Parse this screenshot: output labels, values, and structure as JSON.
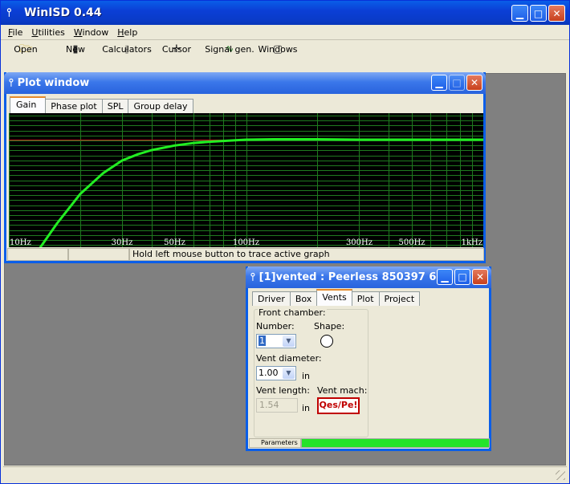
{
  "app": {
    "title": "WinISD 0.44"
  },
  "menu": [
    "File",
    "Utilities",
    "Window",
    "Help"
  ],
  "toolbar": [
    {
      "label": "Open",
      "icon": "folder-open-icon"
    },
    {
      "label": "New",
      "icon": "new-box-icon"
    },
    {
      "label": "Calculators",
      "icon": "calculator-icon"
    },
    {
      "label": "Cursor",
      "icon": "crosshair-cursor-icon"
    },
    {
      "label": "Signal gen.",
      "icon": "sine-wave-icon"
    },
    {
      "label": "Windows",
      "icon": "window-icon"
    }
  ],
  "plot_window": {
    "title": "Plot window",
    "tabs": [
      "Gain",
      "Phase plot",
      "SPL",
      "Group delay"
    ],
    "active_tab": "Gain",
    "status": [
      "",
      "",
      "Hold left mouse button to trace active graph"
    ]
  },
  "chart_data": {
    "type": "line",
    "xscale": "log",
    "xlim": [
      10,
      1000
    ],
    "x_tick_labels": [
      "10Hz",
      "30Hz",
      "50Hz",
      "100Hz",
      "300Hz",
      "500Hz",
      "1kHz"
    ],
    "background": "#000000",
    "grid_color": "#1f7a1f",
    "reference_line_color": "#c81e1e",
    "series": [
      {
        "color": "#22ee22",
        "x": [
          13.5,
          16,
          20,
          25,
          30,
          35,
          40,
          50,
          60,
          70,
          80,
          100,
          130,
          200,
          300,
          500,
          1000
        ],
        "y": [
          -26,
          -20,
          -13,
          -8,
          -5,
          -3.5,
          -2.5,
          -1.4,
          -0.8,
          -0.5,
          -0.3,
          0,
          0.1,
          0.1,
          0,
          0,
          0
        ]
      }
    ]
  },
  "box_window": {
    "title": "[1]vented : Peerless 850397 6....",
    "tabs": [
      "Driver",
      "Box",
      "Vents",
      "Plot",
      "Project"
    ],
    "active_tab": "Vents",
    "group_label": "Front chamber:",
    "number_label": "Number:",
    "number_value": "1",
    "shape_label": "Shape:",
    "shape_icon": "circle-shape-icon",
    "diameter_label": "Vent diameter:",
    "diameter_value": "1.00",
    "diameter_unit": "in",
    "length_label": "Vent length:",
    "length_value": "1.54",
    "length_unit": "in",
    "mach_label": "Vent mach:",
    "mach_value": "Qes/Pe!",
    "status_label": "Parameters",
    "progress": 1.0
  }
}
